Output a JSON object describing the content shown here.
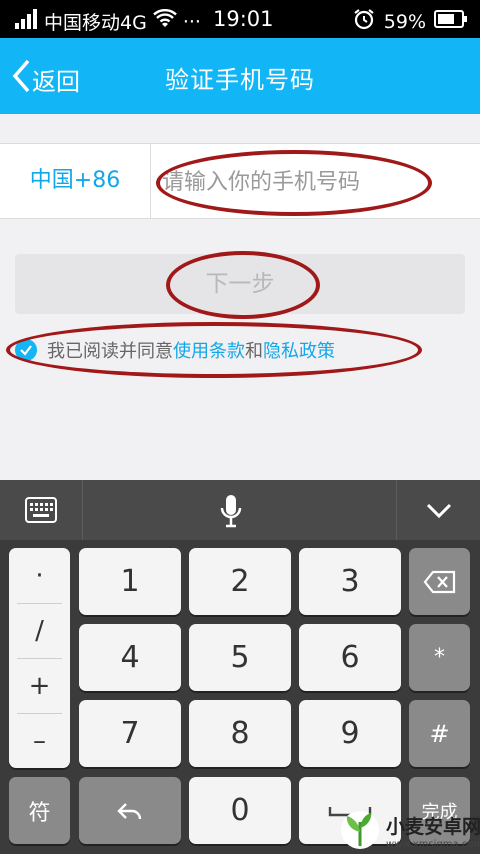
{
  "status_bar": {
    "carrier": "中国移动4G",
    "dots": "···",
    "time": "19:01",
    "battery": "59%"
  },
  "header": {
    "back_label": "返回",
    "title": "验证手机号码"
  },
  "form": {
    "country_code": "中国+86",
    "phone_placeholder": "请输入你的手机号码",
    "phone_value": "",
    "next_label": "下一步",
    "agree_prefix": "我已阅读并同意",
    "terms_link": "使用条款",
    "agree_and": "和",
    "privacy_link": "隐私政策"
  },
  "keyboard": {
    "symbols": [
      "·",
      "/",
      "+",
      "–"
    ],
    "keys": [
      "1",
      "2",
      "3",
      "4",
      "5",
      "6",
      "7",
      "8",
      "9",
      "0"
    ],
    "star": "*",
    "hash": "#",
    "fu": "符",
    "done_partial": "完成"
  },
  "watermark": {
    "name": "小麦安卓网",
    "url": "www.xmsigma.com"
  },
  "colors": {
    "accent": "#12b5f5",
    "link": "#12a7e8",
    "annotation": "#a01818"
  },
  "icons": [
    "signal-icon",
    "wifi-icon",
    "alarm-icon",
    "battery-icon",
    "chevron-left-icon",
    "check-icon",
    "keyboard-icon",
    "microphone-icon",
    "chevron-down-icon",
    "backspace-icon",
    "undo-icon",
    "space-icon"
  ]
}
